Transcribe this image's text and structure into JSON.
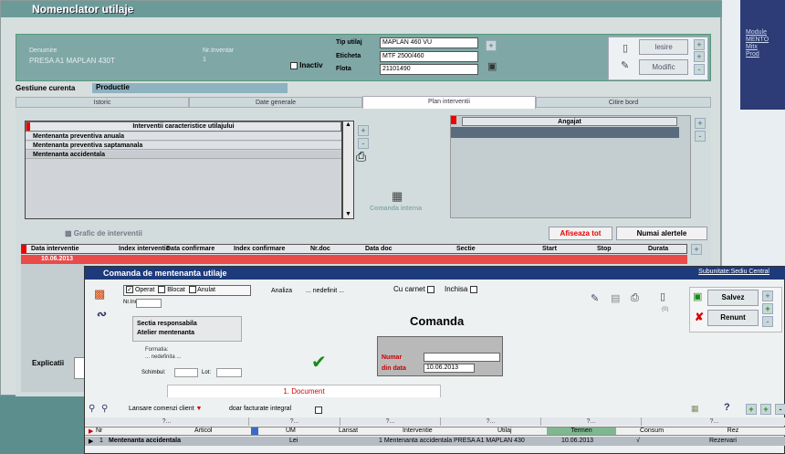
{
  "main_window": {
    "title": "Nomenclator utilaje"
  },
  "header": {
    "denumire_label": "Denumire",
    "denumire_value": "PRESA A1 MAPLAN 430T",
    "nr_inventar_label": "Nr.Inventar",
    "nr_inventar_value": "1",
    "tip_utilaj_label": "Tip utilaj",
    "tip_utilaj_value": "MAPLAN 460 VU",
    "eticheta_label": "Eticheta",
    "eticheta_value": "MTF 2500/460",
    "flota_label": "Flota",
    "flota_value": "21101490",
    "inactiv_label": "Inactiv",
    "iesire_label": "Iesire",
    "modific_label": "Modific"
  },
  "gestiune": {
    "label": "Gestiune curenta",
    "value": "Productie"
  },
  "tabs": [
    "Istoric",
    "Date generale",
    "Plan interventii",
    "Citire bord"
  ],
  "interventii": {
    "header": "Interventii caracteristice utilajului",
    "items": [
      "Mentenanta preventiva anuala",
      "Mentenanta preventiva saptamanala",
      "Mentenanta accidentala"
    ]
  },
  "angajat": {
    "header": "Angajat"
  },
  "comanda_interna_label": "Comanda interna",
  "grafic_label": "Grafic de interventii",
  "afiseaza_tot_label": "Afiseaza tot",
  "numai_alertele_label": "Numai alertele",
  "interventii_table": {
    "columns": [
      "Data interventie",
      "Index interventie",
      "Data confirmare",
      "Index confirmare",
      "Nr.doc",
      "Data doc",
      "Sectie",
      "Start",
      "Stop",
      "Durata"
    ],
    "row_date": "10.06.2013"
  },
  "explicatii_label": "Explicatii",
  "comanda_window": {
    "title": "Comanda de mentenanta utilaje",
    "subunitate": "Subunitate:Sediu Central",
    "operat_label": "Operat",
    "blocat_label": "Blocat",
    "anulat_label": "Anulat",
    "nr_inreg_label": "Nr.Inreg",
    "analiza_label": "Analiza",
    "analiza_value": "... nedefinit ...",
    "cu_carnet_label": "Cu carnet",
    "inchisa_label": "Inchisa",
    "sectia_label": "Sectia responsabila",
    "sectia_value": "Atelier mentenanta",
    "formatia_label": "Formatia:",
    "formatia_value": "... nedefinita ...",
    "schimbul_label": "Schimbul:",
    "lot_label": "Lot:",
    "doc_title": "Comanda",
    "numar_label": "Numar",
    "din_data_label": "din data",
    "din_data_value": "10.06.2013",
    "counter": "(0)",
    "salvez_label": "Salvez",
    "renunt_label": "Renunt",
    "document_tab": "1. Document",
    "lansare_label": "Lansare comenzi client",
    "doar_facturate_label": "doar facturate integral",
    "grid_columns": [
      "Nr",
      "Articol",
      "UM",
      "Lansat",
      "Interventie",
      "Utilaj",
      "Termen",
      "Consum",
      "Rez"
    ],
    "grid_row": {
      "nr": "1",
      "articol": "Mentenanta accidentala",
      "um": "Lei",
      "lansat": "",
      "interventie": "1 Mentenanta accidentala",
      "utilaj": "PRESA A1 MAPLAN 430",
      "termen": "10.06.2013",
      "consum": "√",
      "rez": "Rezervari"
    }
  },
  "right_links": [
    "Module",
    "MENTO",
    "Mitx",
    "Prod"
  ]
}
